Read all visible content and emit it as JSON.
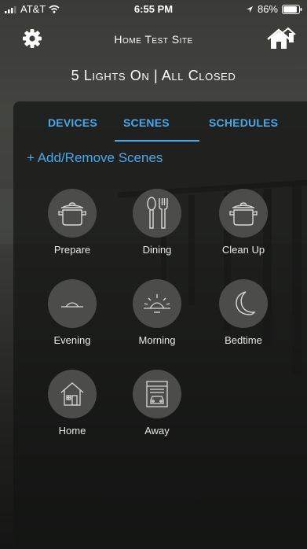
{
  "status_bar": {
    "carrier": "AT&T",
    "time": "6:55 PM",
    "battery": "86%"
  },
  "header": {
    "title": "Home Test Site",
    "settings_icon": "gear-icon",
    "home_icon": "home-icon"
  },
  "summary": "5 Lights On | All Closed",
  "tabs": [
    {
      "label": "DEVICES",
      "active": false
    },
    {
      "label": "SCENES",
      "active": true
    },
    {
      "label": "SCHEDULES",
      "active": false
    }
  ],
  "add_scenes_label": "+ Add/Remove Scenes",
  "scenes": [
    {
      "label": "Prepare",
      "icon": "pot-icon"
    },
    {
      "label": "Dining",
      "icon": "utensils-icon"
    },
    {
      "label": "Clean Up",
      "icon": "pot-icon"
    },
    {
      "label": "Evening",
      "icon": "sunset-icon"
    },
    {
      "label": "Morning",
      "icon": "sunrise-icon"
    },
    {
      "label": "Bedtime",
      "icon": "moon-icon"
    },
    {
      "label": "Home",
      "icon": "house-icon"
    },
    {
      "label": "Away",
      "icon": "garage-icon"
    }
  ],
  "colors": {
    "accent": "#4aa8e8",
    "panel": "#141514",
    "circle": "#4c4d4b"
  }
}
